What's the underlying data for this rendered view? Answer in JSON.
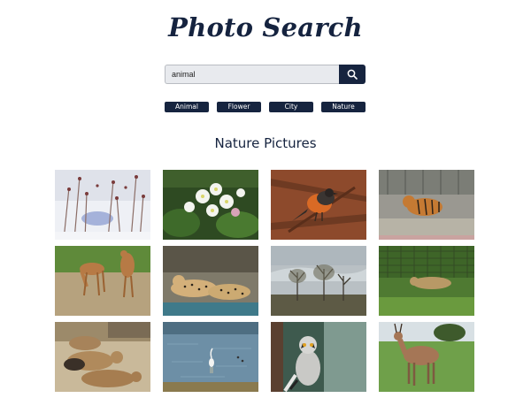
{
  "app": {
    "title": "Photo Search"
  },
  "search": {
    "value": "animal",
    "button_icon": "search-icon"
  },
  "filters": [
    {
      "label": "Animal"
    },
    {
      "label": "Flower"
    },
    {
      "label": "City"
    },
    {
      "label": "Nature"
    }
  ],
  "gallery": {
    "heading": "Nature Pictures",
    "photos": [
      {
        "subject": "snowy-branches-photo"
      },
      {
        "subject": "white-flowers-photo"
      },
      {
        "subject": "robin-bird-photo"
      },
      {
        "subject": "tiger-photo"
      },
      {
        "subject": "deer-grazing-photo"
      },
      {
        "subject": "cheetahs-resting-photo"
      },
      {
        "subject": "misty-trees-photo"
      },
      {
        "subject": "cheetah-grass-photo"
      },
      {
        "subject": "maras-photo"
      },
      {
        "subject": "heron-water-photo"
      },
      {
        "subject": "lemur-photo"
      },
      {
        "subject": "antelope-photo"
      }
    ]
  },
  "colors": {
    "primary": "#16243f",
    "input_background": "#e8eaee",
    "page_background": "#ffffff"
  }
}
